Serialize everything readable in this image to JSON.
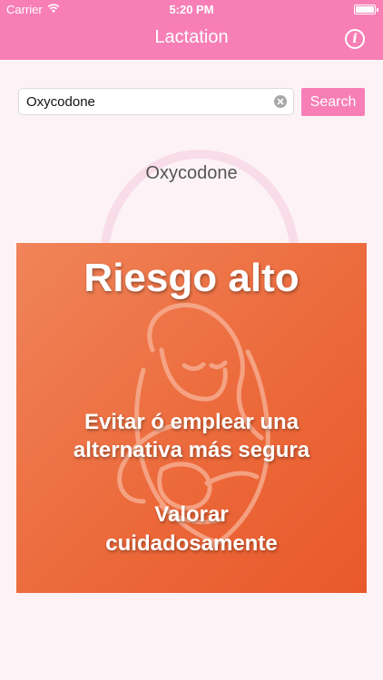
{
  "status_bar": {
    "carrier": "Carrier",
    "time": "5:20 PM",
    "icons": {
      "wifi": "wifi-icon",
      "battery": "battery-icon"
    }
  },
  "nav": {
    "title": "Lactation",
    "info_icon": "info-icon"
  },
  "search": {
    "value": "Oxycodone",
    "button_label": "Search",
    "clear_icon": "clear-icon"
  },
  "result": {
    "drug_name": "Oxycodone",
    "risk_level": "Riesgo alto",
    "advice_lines": [
      "Evitar ó emplear una",
      "alternativa más segura"
    ],
    "action_lines": [
      "Valorar",
      "cuidadosamente"
    ]
  },
  "colors": {
    "header": "#f77fb6",
    "search_button": "#f77fb6",
    "risk_card": "#ec6a3b",
    "background": "#fdf3f7",
    "text_on_card": "#ffffff"
  }
}
